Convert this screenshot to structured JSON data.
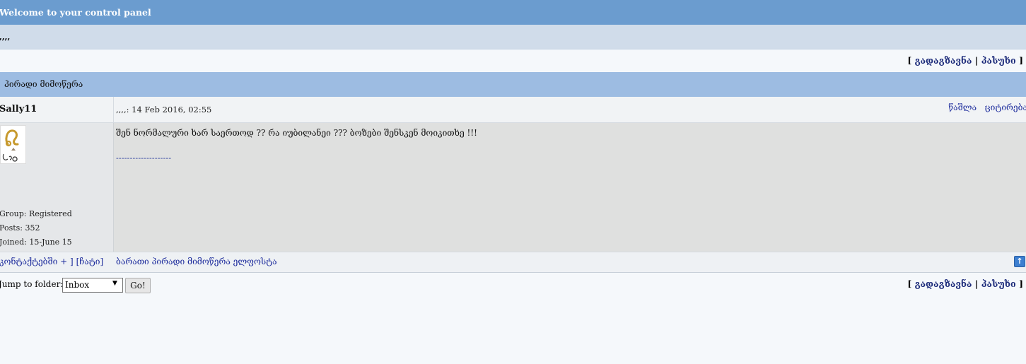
{
  "header": {
    "title": "Welcome to your control panel"
  },
  "subbar": {
    "text": ",,,,"
  },
  "actions": {
    "bracket_open": "[",
    "forward_label": "გადაგზავნა",
    "separator": "|",
    "reply_label": "პასუხი",
    "bracket_close": "]"
  },
  "pm_section": {
    "title": "პირადი მიმოწერა"
  },
  "post": {
    "author": "Sally11",
    "meta": ",,,,: 14 Feb 2016, 02:55",
    "delete_label": "წაშლა",
    "quote_label": "ციტირება",
    "message": "შენ ნორმალური ხარ საერთოდ ?? რა იუბილანეი ??? ბოზები შენსკენ მოიკითხე !!!",
    "signature": "--------------------"
  },
  "user": {
    "avatar_icon": "leo-zodiac-avatar",
    "group": "Group: Registered",
    "posts": "Posts: 352",
    "joined": "Joined: 15-June 15"
  },
  "footer_row": {
    "contacts_link": "კონტაქტებში + ]",
    "chat_link": "[ჩატი]",
    "links": [
      "ბარათი",
      "პირადი მიმოწერა",
      "ელფოსტა"
    ],
    "top_icon": "arrow-up-icon"
  },
  "jump": {
    "label": "Jump to folder:",
    "selected": "Inbox",
    "go_label": "Go!"
  }
}
